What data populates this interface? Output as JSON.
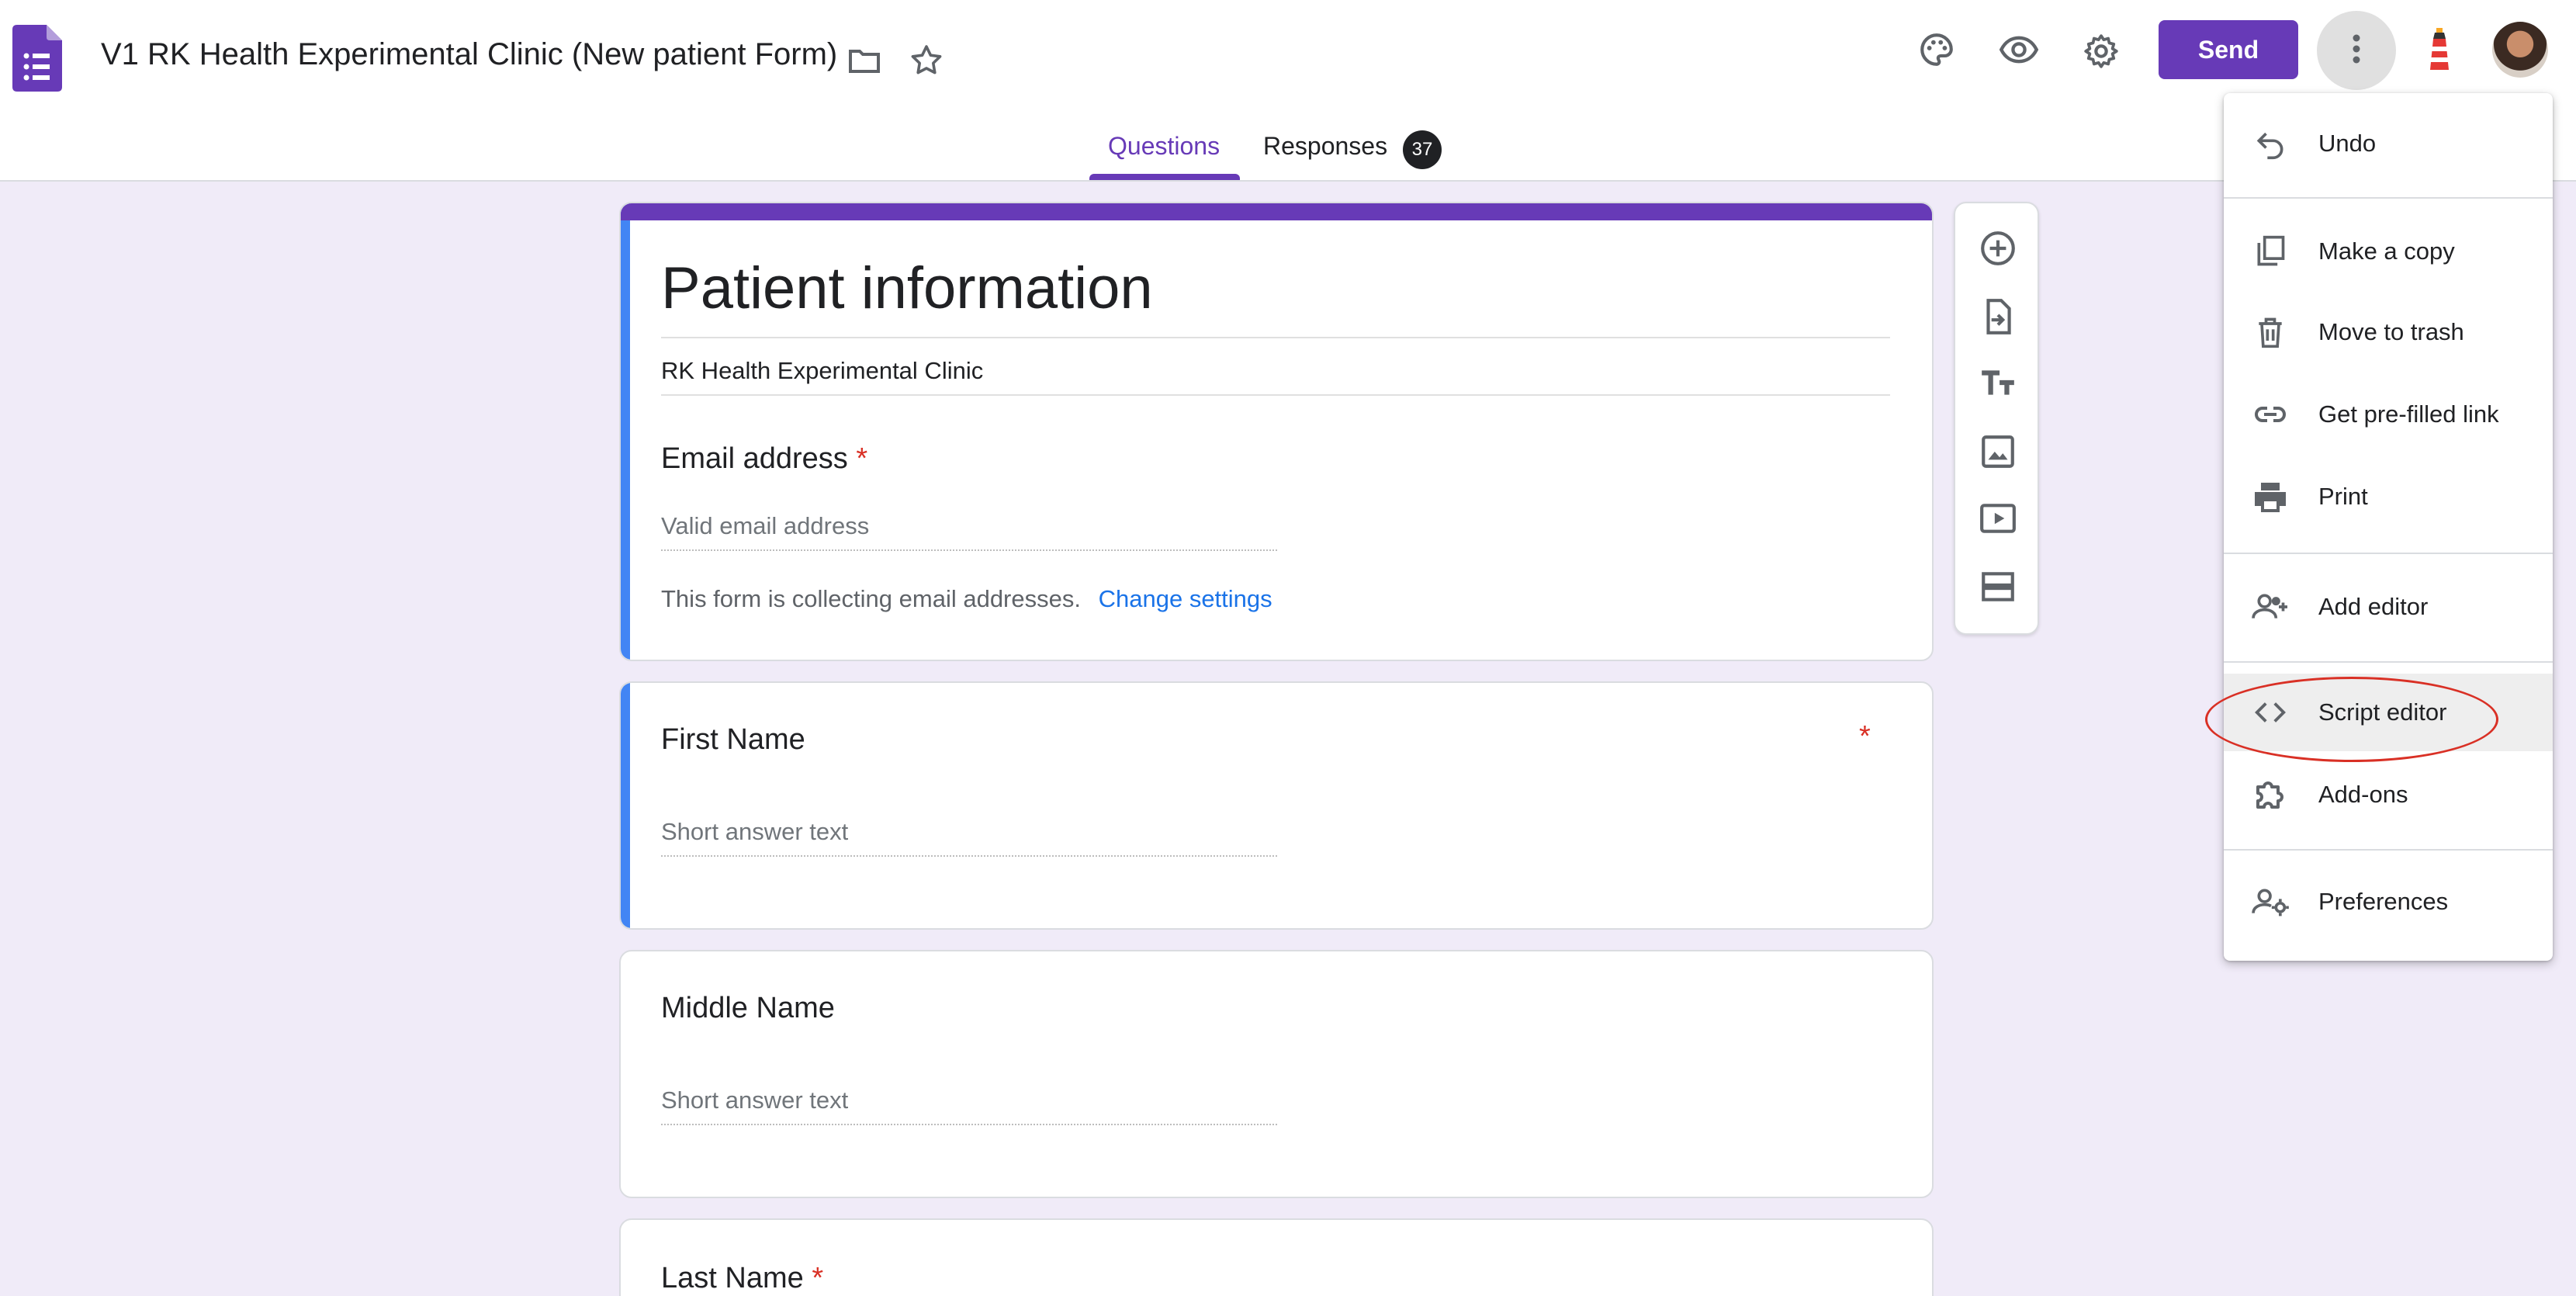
{
  "header": {
    "title": "V1 RK Health Experimental Clinic (New patient Form)",
    "send_label": "Send",
    "icons": [
      "forms-logo-icon",
      "folder-icon",
      "star-icon",
      "palette-icon",
      "eye-preview-icon",
      "gear-icon",
      "more-vert-icon",
      "lighthouse-addon-icon",
      "avatar"
    ]
  },
  "tabs": {
    "questions": "Questions",
    "responses": "Responses",
    "responses_count": "37"
  },
  "form": {
    "title": "Patient information",
    "description": "RK Health Experimental Clinic",
    "email": {
      "label": "Email address",
      "required": "*",
      "placeholder": "Valid email address",
      "note": "This form is collecting email addresses.",
      "note_link": "Change settings"
    },
    "questions": [
      {
        "label": "First Name",
        "required": "*",
        "placeholder": "Short answer text"
      },
      {
        "label": "Middle Name",
        "required": "",
        "placeholder": "Short answer text"
      },
      {
        "label": "Last Name",
        "required": "*",
        "placeholder": ""
      }
    ]
  },
  "side_toolbar": [
    "add-question-icon",
    "import-questions-icon",
    "add-title-icon",
    "add-image-icon",
    "add-video-icon",
    "add-section-icon"
  ],
  "menu": {
    "items": [
      {
        "label": "Undo",
        "icon": "undo-icon"
      },
      {
        "label": "Make a copy",
        "icon": "copy-icon"
      },
      {
        "label": "Move to trash",
        "icon": "trash-icon"
      },
      {
        "label": "Get pre-filled link",
        "icon": "link-icon"
      },
      {
        "label": "Print",
        "icon": "print-icon"
      },
      {
        "label": "Add editor",
        "icon": "add-person-icon"
      },
      {
        "label": "Script editor",
        "icon": "code-icon",
        "highlighted": true
      },
      {
        "label": "Add-ons",
        "icon": "puzzle-icon"
      },
      {
        "label": "Preferences",
        "icon": "person-settings-icon"
      }
    ]
  },
  "colors": {
    "brand": "#673ab7",
    "background": "#f0ebf8",
    "active_card_accent": "#4285f4",
    "required": "#d93025",
    "link": "#1a73e8",
    "annotation": "#d93025"
  }
}
